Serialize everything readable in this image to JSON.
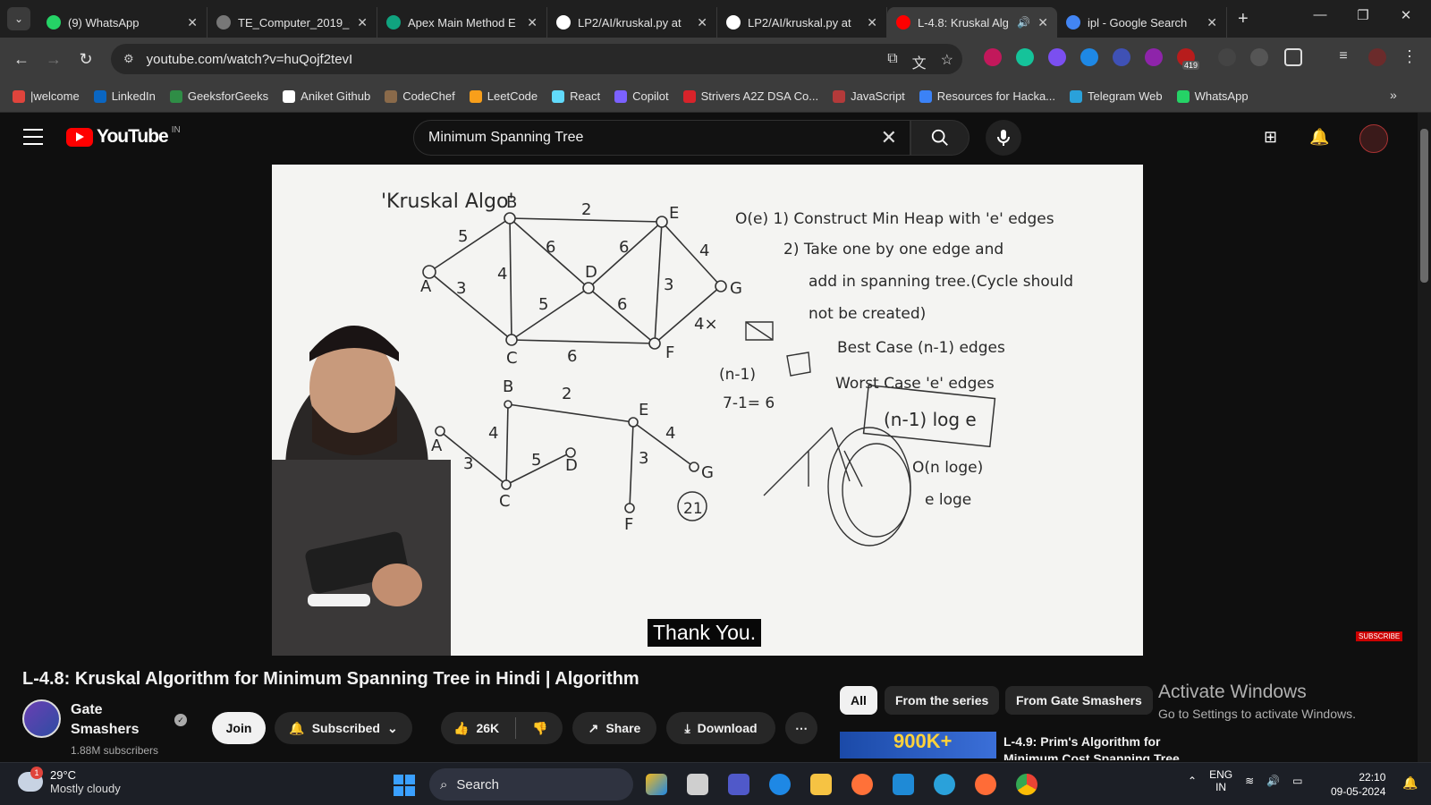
{
  "browser": {
    "tabs": [
      {
        "title": "(9) WhatsApp",
        "icon": "whatsapp-icon",
        "color": "#25d366"
      },
      {
        "title": "TE_Computer_2019_C",
        "icon": "globe-icon",
        "color": "#777777"
      },
      {
        "title": "Apex Main Method E",
        "icon": "chatgpt-icon",
        "color": "#10a37f"
      },
      {
        "title": "LP2/AI/kruskal.py at",
        "icon": "github-icon",
        "color": "#ffffff"
      },
      {
        "title": "LP2/AI/kruskal.py at",
        "icon": "github-icon",
        "color": "#ffffff"
      },
      {
        "title": "L-4.8: Kruskal Alg",
        "icon": "youtube-icon",
        "color": "#ff0000",
        "active": true
      },
      {
        "title": "ipl - Google Search",
        "icon": "google-icon",
        "color": "#4285f4"
      }
    ],
    "url": "youtube.com/watch?v=huQojf2tevI",
    "extension_badge": "419",
    "bookmarks": [
      {
        "label": "|welcome",
        "color": "#e0443c"
      },
      {
        "label": "LinkedIn",
        "color": "#0a66c2"
      },
      {
        "label": "GeeksforGeeks",
        "color": "#2f8d46"
      },
      {
        "label": "Aniket Github",
        "color": "#ffffff"
      },
      {
        "label": "CodeChef",
        "color": "#8a6a4a"
      },
      {
        "label": "LeetCode",
        "color": "#f89f1b"
      },
      {
        "label": "React",
        "color": "#61dafb"
      },
      {
        "label": "Copilot",
        "color": "#7b61ff"
      },
      {
        "label": "Strivers A2Z DSA Co...",
        "color": "#d8232a"
      },
      {
        "label": "JavaScript",
        "color": "#b33a3a"
      },
      {
        "label": "Resources for Hacka...",
        "color": "#3b82f6"
      },
      {
        "label": "Telegram Web",
        "color": "#2aa1da"
      },
      {
        "label": "WhatsApp",
        "color": "#25d366"
      }
    ]
  },
  "youtube": {
    "logo_text": "YouTube",
    "country": "IN",
    "search_value": "Minimum Spanning Tree",
    "caption": "Thank You.",
    "watermark": "SUBSCRIBE",
    "video_title": "L-4.8: Kruskal Algorithm for Minimum Spanning Tree in Hindi | Algorithm",
    "channel": {
      "name": "Gate Smashers",
      "subscribers": "1.88M subscribers"
    },
    "actions": {
      "join": "Join",
      "subscribed": "Subscribed",
      "likes": "26K",
      "share": "Share",
      "download": "Download"
    },
    "chips": [
      "All",
      "From the series",
      "From Gate Smashers"
    ],
    "recommendation": {
      "thumb_text": "900K+",
      "title": "L-4.9: Prim's Algorithm for Minimum Cost Spanning Tree |"
    }
  },
  "whiteboard": {
    "heading": "'Kruskal Algo'",
    "steps": [
      "O(e)  1) Construct Min Heap with 'e' edges",
      "2) Take one by one edge and",
      "add in spanning tree.(Cycle should",
      "not be created)"
    ],
    "best_case": "Best Case (n-1) edges",
    "worst_case": "Worst Case 'e' edges",
    "formula1": "(n-1)",
    "formula2": "7-1= 6",
    "complexity_box": "(n-1) log e",
    "complexity2": "O(n loge)",
    "complexity3": "e loge",
    "total": "21"
  },
  "windows_watermark": {
    "line1": "Activate Windows",
    "line2": "Go to Settings to activate Windows."
  },
  "taskbar": {
    "weather_temp": "29°C",
    "weather_desc": "Mostly cloudy",
    "weather_badge": "1",
    "search_label": "Search",
    "lang1": "ENG",
    "lang2": "IN",
    "time": "22:10",
    "date": "09-05-2024"
  }
}
